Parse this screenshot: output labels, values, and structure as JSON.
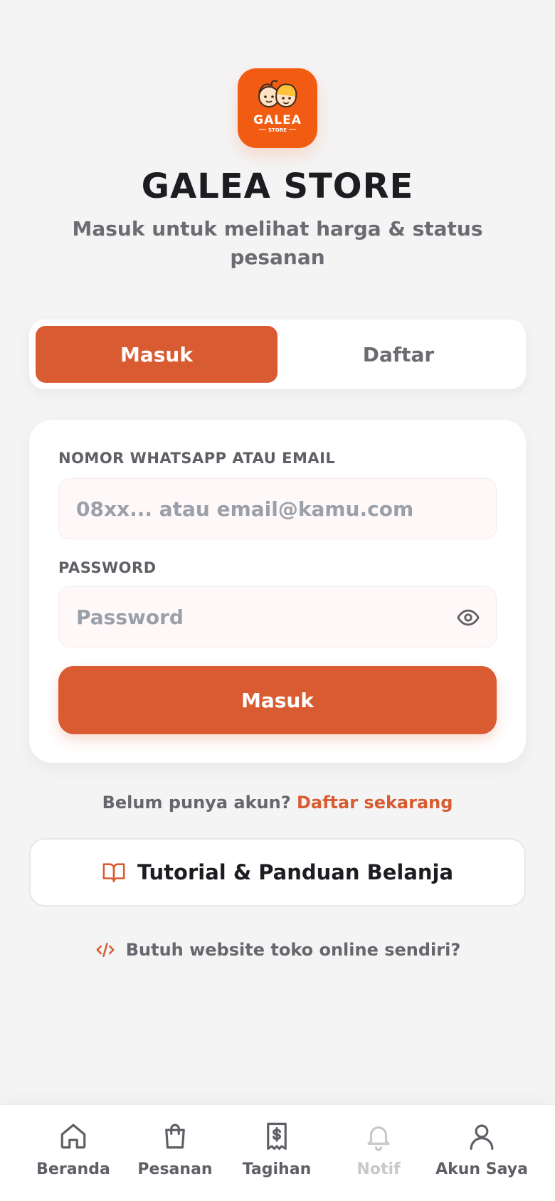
{
  "brand": {
    "logo_text": "GALEA",
    "logo_subtext": "STORE",
    "title": "GALEA STORE",
    "subtitle": "Masuk untuk melihat harga & status pesanan",
    "accent_color": "#d95b32",
    "logo_color": "#f25c12"
  },
  "tabs": {
    "login_label": "Masuk",
    "register_label": "Daftar",
    "active": "login"
  },
  "form": {
    "identifier_label": "NOMOR WHATSAPP ATAU EMAIL",
    "identifier_placeholder": "08xx... atau email@kamu.com",
    "identifier_value": "",
    "password_label": "PASSWORD",
    "password_placeholder": "Password",
    "password_value": "",
    "submit_label": "Masuk",
    "password_toggle_icon": "eye-icon"
  },
  "register_prompt": {
    "text": "Belum punya akun? ",
    "link_label": "Daftar sekarang"
  },
  "tutorial": {
    "icon": "book-open-icon",
    "label": "Tutorial & Panduan Belanja"
  },
  "website_promo": {
    "icon": "code-icon",
    "label": "Butuh website toko online sendiri?"
  },
  "bottom_nav": {
    "items": [
      {
        "label": "Beranda",
        "icon": "home-icon",
        "disabled": false
      },
      {
        "label": "Pesanan",
        "icon": "shopping-bag-icon",
        "disabled": false
      },
      {
        "label": "Tagihan",
        "icon": "receipt-icon",
        "disabled": false
      },
      {
        "label": "Notif",
        "icon": "bell-icon",
        "disabled": true
      },
      {
        "label": "Akun Saya",
        "icon": "user-icon",
        "disabled": false
      }
    ]
  }
}
